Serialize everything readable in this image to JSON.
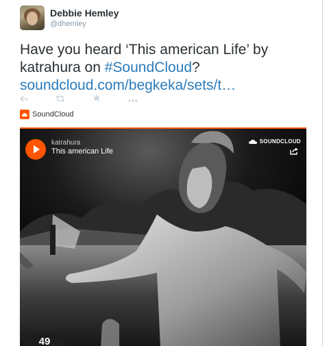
{
  "user": {
    "name": "Debbie Hemley",
    "handle": "@dhemley"
  },
  "tweet": {
    "text_before": "Have you heard ‘This american Life’ by katrahura on ",
    "hashtag": "#SoundCloud",
    "text_after": "?",
    "link": "soundcloud.com/begkeka/sets/t…"
  },
  "actions": {
    "reply_icon": "reply-icon",
    "retweet_icon": "retweet-icon",
    "favorite_icon": "star-icon",
    "more_icon": "more-icon"
  },
  "card": {
    "source_label": "SoundCloud",
    "accent_color": "#ff5500"
  },
  "player": {
    "artist": "katrahura",
    "title": "This american Life",
    "brand": "SOUNDCLOUD",
    "play_count": "49"
  },
  "colors": {
    "text": "#292f33",
    "muted": "#8899a6",
    "link": "#2b7bb9",
    "action_icons": "#ccd6dd"
  }
}
